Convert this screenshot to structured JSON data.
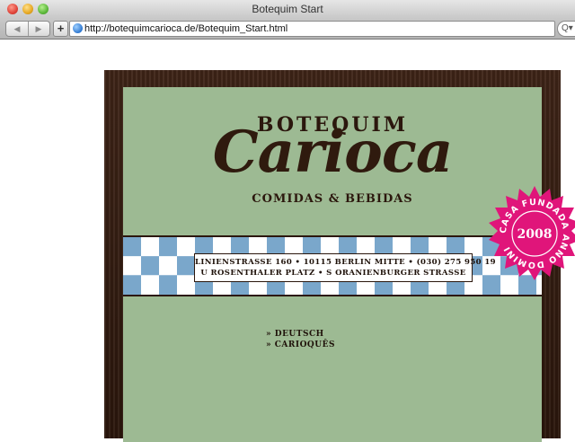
{
  "window": {
    "title": "Botequim Start"
  },
  "toolbar": {
    "back_icon": "back-arrow-icon",
    "forward_icon": "forward-arrow-icon",
    "add_label": "+",
    "url": "http://botequimcarioca.de/Botequim_Start.html",
    "search_icon": "Q▾"
  },
  "colors": {
    "panel": "#9dba93",
    "frame": "#2f1a0e",
    "checker_blue": "#7aa7cb",
    "stamp": "#e0157a"
  },
  "logo": {
    "top": "BOTEQUIM",
    "main": "Carioca",
    "sub": "COMIDAS & BEBIDAS"
  },
  "address": {
    "line1": "LINIENSTRASSE 160 • 10115 BERLIN MITTE • (030) 275 950 19",
    "line2": "U ROSENTHALER PLATZ • S ORANIENBURGER STRASSE"
  },
  "nav": {
    "deutsch": "» DEUTSCH",
    "carioques": "» CARIOQUÊS"
  },
  "stamp": {
    "ring_text": "CASA FUNDADA ANNO DOMINI",
    "year": "2008"
  }
}
